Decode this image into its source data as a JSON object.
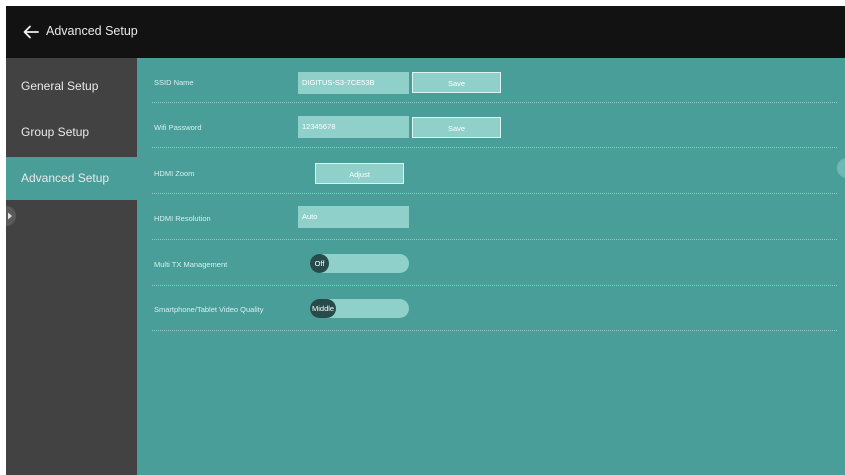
{
  "header": {
    "title": "Advanced Setup",
    "back_icon": "arrow-left-icon"
  },
  "sidebar": {
    "items": [
      {
        "label": "General Setup",
        "active": false
      },
      {
        "label": "Group Setup",
        "active": false
      },
      {
        "label": "Advanced Setup",
        "active": true
      }
    ]
  },
  "settings": {
    "ssid": {
      "label": "SSID Name",
      "value": "DIGITUS-S3-7CE53B",
      "button": "Save"
    },
    "wifi_password": {
      "label": "Wifi Password",
      "value": "12345678",
      "button": "Save"
    },
    "hdmi_zoom": {
      "label": "HDMI Zoom",
      "button": "Adjust"
    },
    "hdmi_resolution": {
      "label": "HDMI Resolution",
      "value": "Auto"
    },
    "multi_tx": {
      "label": "Multi TX Management",
      "value": "Off"
    },
    "video_quality": {
      "label": "Smartphone/Tablet Video Quality",
      "value": "Middle"
    }
  },
  "colors": {
    "accent": "#4a9e9a",
    "sidebar": "#424242",
    "topbar": "#121212",
    "field": "#8fd0ca",
    "toggle_knob": "#264b4a"
  }
}
